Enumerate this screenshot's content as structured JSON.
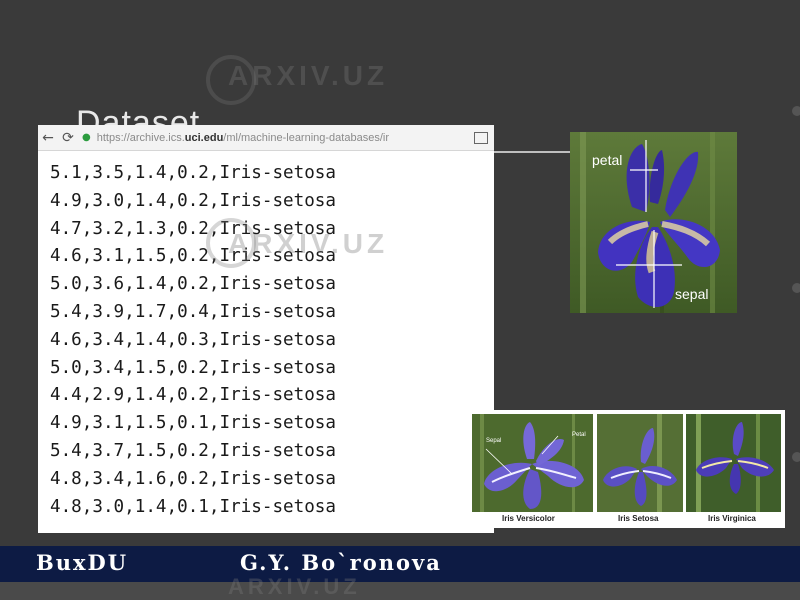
{
  "slide": {
    "title": "Dataset"
  },
  "browser": {
    "url_prefix": "https://archive.ics.",
    "url_domain": "uci.edu",
    "url_path": "/ml/machine-learning-databases/ir"
  },
  "data_lines": [
    "5.1,3.5,1.4,0.2,Iris-setosa",
    "4.9,3.0,1.4,0.2,Iris-setosa",
    "4.7,3.2,1.3,0.2,Iris-setosa",
    "4.6,3.1,1.5,0.2,Iris-setosa",
    "5.0,3.6,1.4,0.2,Iris-setosa",
    "5.4,3.9,1.7,0.4,Iris-setosa",
    "4.6,3.4,1.4,0.3,Iris-setosa",
    "5.0,3.4,1.5,0.2,Iris-setosa",
    "4.4,2.9,1.4,0.2,Iris-setosa",
    "4.9,3.1,1.5,0.1,Iris-setosa",
    "5.4,3.7,1.5,0.2,Iris-setosa",
    "4.8,3.4,1.6,0.2,Iris-setosa",
    "4.8,3.0,1.4,0.1,Iris-setosa"
  ],
  "flower": {
    "petal_label": "petal",
    "sepal_label": "sepal"
  },
  "species": {
    "versicolor": "Iris Versicolor",
    "setosa": "Iris Setosa",
    "virginica": "Iris Virginica",
    "petal_small": "Petal",
    "sepal_small": "Sepal"
  },
  "footer": {
    "left": "BuxDU",
    "right": "G.Y. Bo`ronova"
  },
  "watermark": "ARXIV.UZ",
  "colors": {
    "background": "#3a3a3a",
    "footer": "#0d1b44",
    "iris_purple": "#4a3fb5"
  }
}
